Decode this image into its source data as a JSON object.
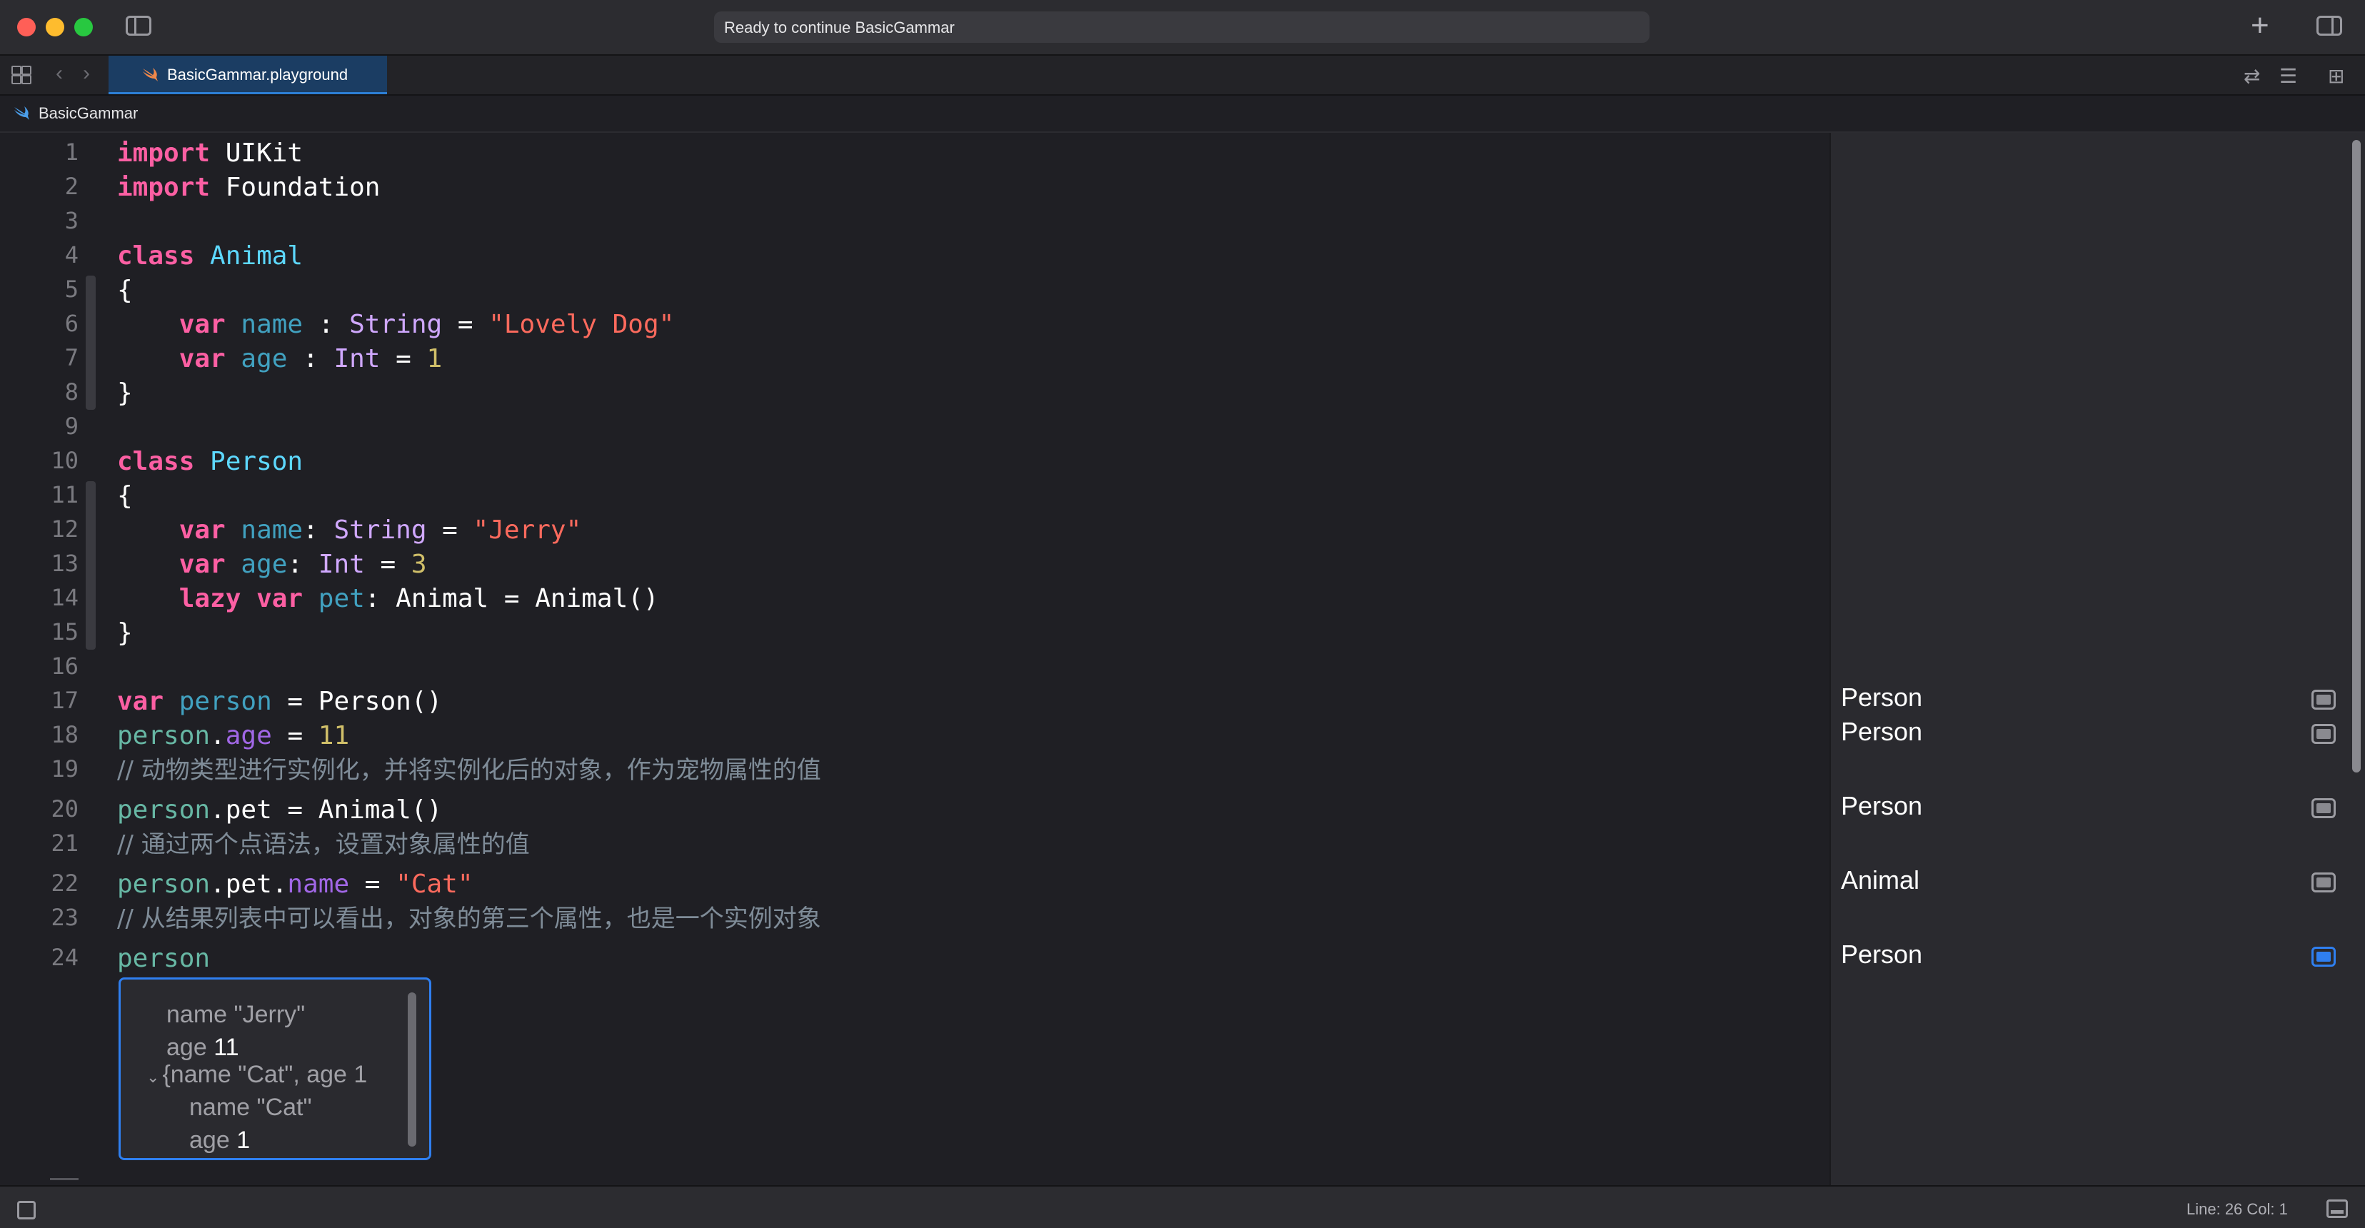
{
  "window": {
    "activity_status": "Ready to continue BasicGammar"
  },
  "tabbar": {
    "active_tab": "BasicGammar.playground"
  },
  "jumpbar": {
    "path": "BasicGammar"
  },
  "editor": {
    "line_numbers": [
      "1",
      "2",
      "3",
      "4",
      "5",
      "6",
      "7",
      "8",
      "9",
      "10",
      "11",
      "12",
      "13",
      "14",
      "15",
      "16",
      "17",
      "18",
      "19",
      "20",
      "21",
      "22",
      "23",
      "24"
    ],
    "tokens": {
      "l1_kw": "import",
      "l1_rest": " UIKit",
      "l2_kw": "import",
      "l2_rest": " Foundation",
      "l4_kw": "class",
      "l4_name": " Animal",
      "l5": "{",
      "l6_kw": "    var",
      "l6_prop": " name",
      "l6_sep": " : ",
      "l6_type": "String",
      "l6_eq": " = ",
      "l6_str": "\"Lovely Dog\"",
      "l7_kw": "    var",
      "l7_prop": " age",
      "l7_sep": " : ",
      "l7_type": "Int",
      "l7_eq": " = ",
      "l7_num": "1",
      "l8": "}",
      "l10_kw": "class",
      "l10_name": " Person",
      "l11": "{",
      "l12_kw": "    var",
      "l12_prop": " name",
      "l12_sep": ": ",
      "l12_type": "String",
      "l12_eq": " = ",
      "l12_str": "\"Jerry\"",
      "l13_kw": "    var",
      "l13_prop": " age",
      "l13_sep": ": ",
      "l13_type": "Int",
      "l13_eq": " = ",
      "l13_num": "3",
      "l14_kw": "    lazy var",
      "l14_prop": " pet",
      "l14_rest": ": Animal = Animal()",
      "l15": "}",
      "l17_kw": "var",
      "l17_var": " person",
      "l17_rest": " = Person()",
      "l18_var": "person",
      "l18_dot": ".",
      "l18_prop": "age",
      "l18_eq": " = ",
      "l18_num": "11",
      "l19_cmt": "// 动物类型进行实例化，并将实例化后的对象，作为宠物属性的值",
      "l20_var": "person",
      "l20_rest": ".pet = Animal()",
      "l21_cmt": "// 通过两个点语法，设置对象属性的值",
      "l22_var": "person",
      "l22_mid": ".pet.",
      "l22_prop": "name",
      "l22_eq": " = ",
      "l22_str": "\"Cat\"",
      "l23_cmt": "// 从结果列表中可以看出，对象的第三个属性，也是一个实例对象",
      "l24_var": "person"
    },
    "popover": {
      "row1_key": "name",
      "row1_val": "\"Jerry\"",
      "row2_key": "age",
      "row2_val": "11",
      "row3_text": "{name \"Cat\", age 1",
      "row4_key": "name",
      "row4_val": "\"Cat\"",
      "row5_key": "age",
      "row5_val": "1"
    }
  },
  "results": {
    "items": [
      {
        "label": "Person",
        "active": false
      },
      {
        "label": "Person",
        "active": false
      },
      {
        "label": "Person",
        "active": false
      },
      {
        "label": "Animal",
        "active": false
      },
      {
        "label": "Person",
        "active": true
      }
    ]
  },
  "statusbar": {
    "position": "Line: 26  Col: 1"
  },
  "colors": {
    "keyword": "#fc5fa3",
    "type_decl": "#5dd8ff",
    "string": "#fc6a5d",
    "number": "#d0bf69",
    "comment": "#7f8c98",
    "accent": "#2f7ff0"
  }
}
